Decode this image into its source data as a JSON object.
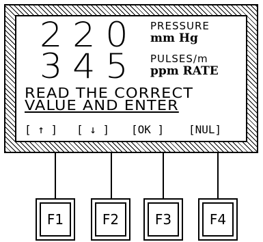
{
  "display": {
    "pressure_value": "220",
    "pressure_label": "PRESSURE",
    "pressure_unit": "mm Hg",
    "pulse_value": "345",
    "pulse_label": "PULSES/m",
    "pulse_unit": "ppm RATE",
    "message_line1": "READ THE CORRECT",
    "message_line2": "VALUE AND ENTER"
  },
  "softkeys": [
    "[ ↑ ]",
    "[ ↓ ]",
    "[OK ]",
    "[NUL]"
  ],
  "function_keys": [
    "F1",
    "F2",
    "F3",
    "F4"
  ]
}
